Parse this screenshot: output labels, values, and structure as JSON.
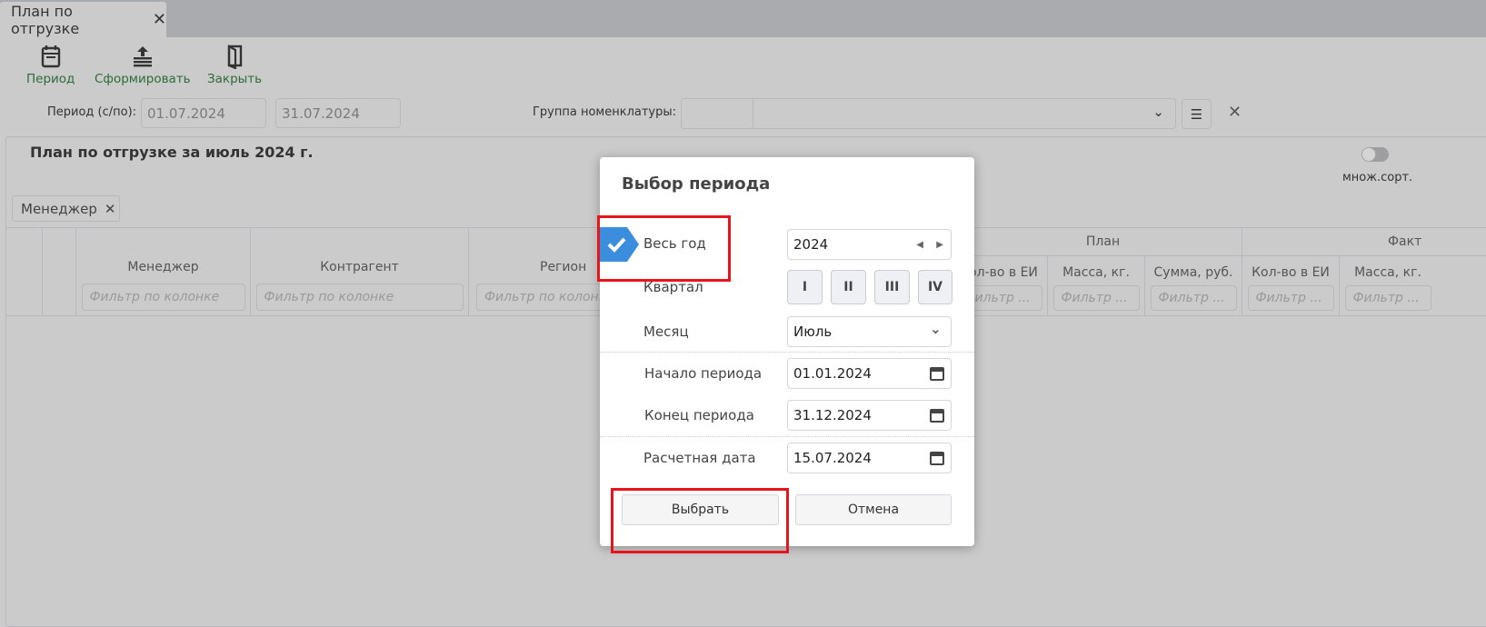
{
  "tab": {
    "title": "План по отгрузке"
  },
  "toolbar": {
    "period": "Период",
    "build": "Сформировать",
    "close": "Закрыть"
  },
  "filters": {
    "period_label": "Период (с/по):",
    "date_from": "01.07.2024",
    "date_to": "31.07.2024",
    "group_label": "Группа номенклатуры:"
  },
  "report": {
    "title": "План по отгрузке за июль 2024 г.",
    "multisort": "множ.сорт.",
    "multisort_on": false,
    "group_chip": "Менеджер"
  },
  "grid": {
    "columns": [
      "Менеджер",
      "Контрагент",
      "Регион"
    ],
    "filter_placeholder": "Фильтр по колонке",
    "groups": [
      "План",
      "Факт"
    ],
    "sub_columns": [
      "Кол-во в ЕИ",
      "Масса, кг.",
      "Сумма, руб.",
      "Кол-во в ЕИ",
      "Масса, кг."
    ],
    "sub_filter_placeholder": "Фильтр ..."
  },
  "dialog": {
    "title": "Выбор периода",
    "whole_year": "Весь год",
    "whole_year_checked": true,
    "year": "2024",
    "quarter_label": "Квартал",
    "quarters": [
      "I",
      "II",
      "III",
      "IV"
    ],
    "month_label": "Месяц",
    "month": "Июль",
    "start_label": "Начало периода",
    "start": "01.01.2024",
    "end_label": "Конец периода",
    "end": "31.12.2024",
    "calc_label": "Расчетная дата",
    "calc": "15.07.2024",
    "ok": "Выбрать",
    "cancel": "Отмена"
  },
  "colors": {
    "accent": "#3b8ddd",
    "highlight": "#e8141c",
    "toolbar_text": "#2e6b3a"
  }
}
